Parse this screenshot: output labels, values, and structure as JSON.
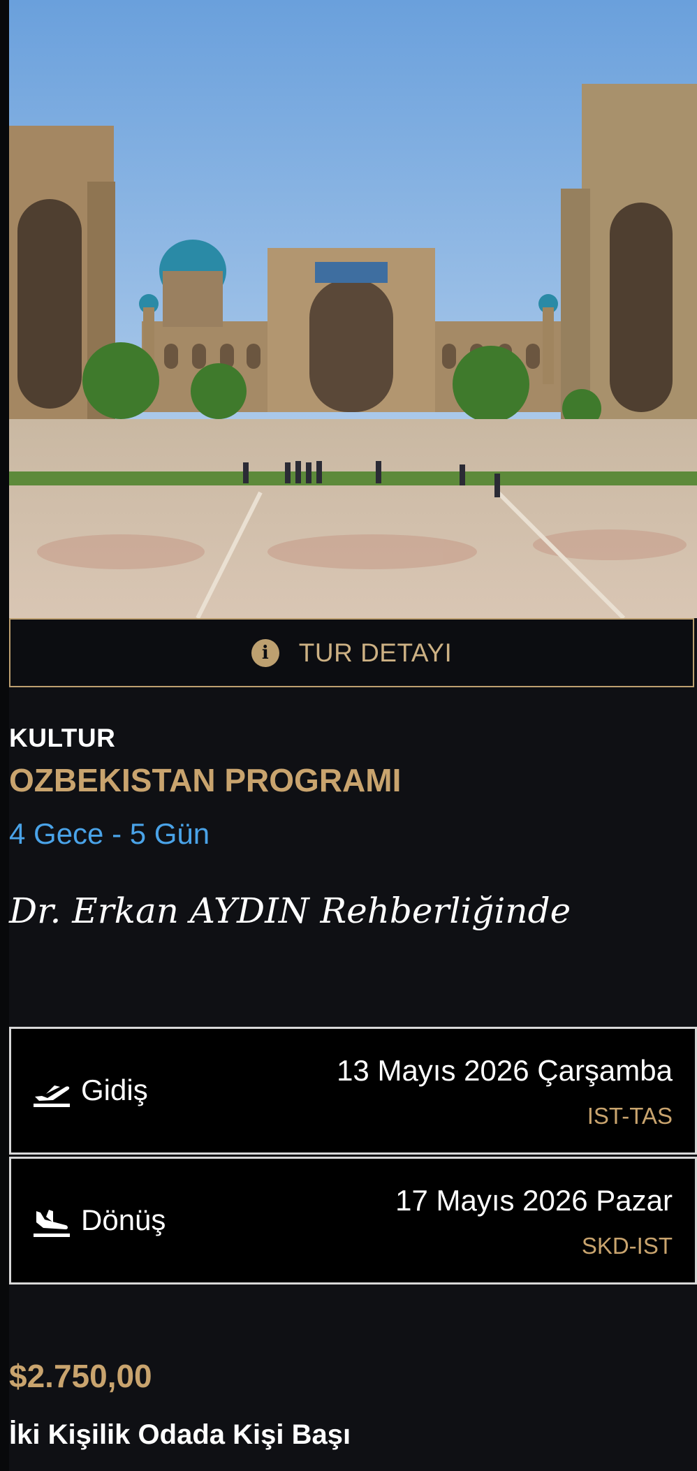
{
  "tour": {
    "detail_button_label": "TUR DETAYI",
    "info_icon": "info-icon",
    "category": "KULTUR",
    "title": "OZBEKISTAN PROGRAMI",
    "duration": "4 Gece - 5 Gün",
    "guide": "Dr. Erkan AYDIN Rehberliğinde"
  },
  "flights": [
    {
      "icon": "plane-departure-icon",
      "label": "Gidiş",
      "date": "13 Mayıs 2026 Çarşamba",
      "route": "IST-TAS"
    },
    {
      "icon": "plane-arrival-icon",
      "label": "Dönüş",
      "date": "17 Mayıs 2026 Pazar",
      "route": "SKD-IST"
    }
  ],
  "pricing": {
    "price": "$2.750,00",
    "note": "İki Kişilik Odada Kişi Başı"
  },
  "colors": {
    "background": "#0f1014",
    "gold_accent": "#c9a46e",
    "blue_accent": "#4aa3e8",
    "flight_box_border": "#d8d8d8"
  }
}
